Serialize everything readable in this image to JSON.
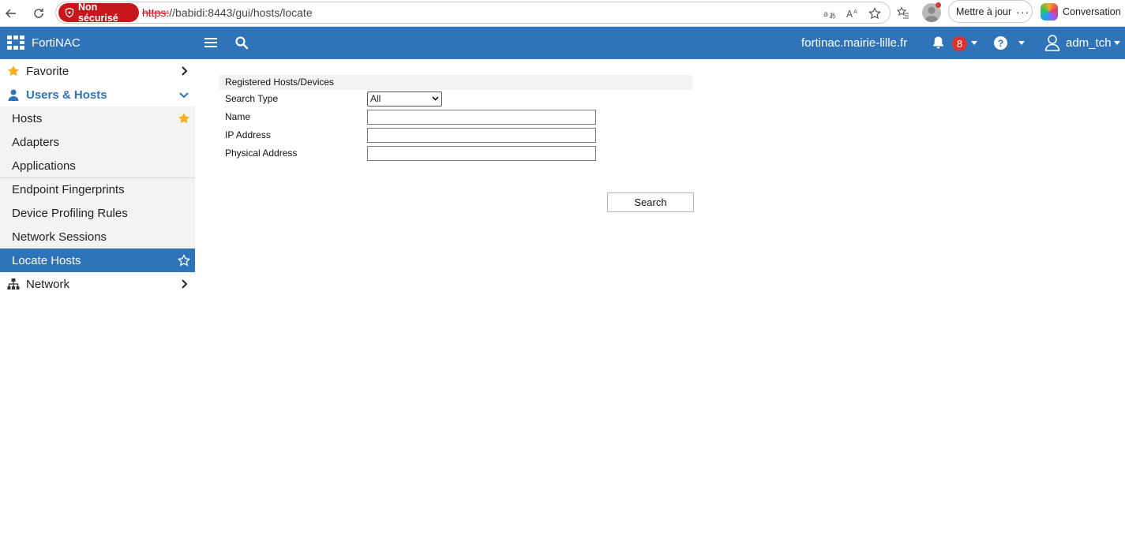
{
  "browser": {
    "security_label": "Non sécurisé",
    "url_proto": "https:",
    "url_rest": "//babidi:8443/gui/hosts/locate",
    "update_label": "Mettre à jour",
    "update_more": "···",
    "copilot_label": "Conversation",
    "read_aloud_glyph": "Aᴬ"
  },
  "app": {
    "title": "FortiNAC",
    "hostname": "fortinac.mairie-lille.fr",
    "notification_count": "8",
    "help_glyph": "?",
    "username": "adm_tch",
    "accent_color": "#2f74b9"
  },
  "sidebar": {
    "favorite": "Favorite",
    "users_hosts": "Users & Hosts",
    "items": [
      {
        "label": "Hosts"
      },
      {
        "label": "Adapters"
      },
      {
        "label": "Applications"
      },
      {
        "label": "Endpoint Fingerprints"
      },
      {
        "label": "Device Profiling Rules"
      },
      {
        "label": "Network Sessions"
      },
      {
        "label": "Locate Hosts"
      }
    ],
    "network": "Network"
  },
  "form": {
    "panel_title": "Registered Hosts/Devices",
    "search_type_label": "Search Type",
    "search_type_value": "All",
    "name_label": "Name",
    "ip_label": "IP Address",
    "physical_label": "Physical Address",
    "name_value": "",
    "ip_value": "",
    "physical_value": "",
    "search_button": "Search"
  }
}
